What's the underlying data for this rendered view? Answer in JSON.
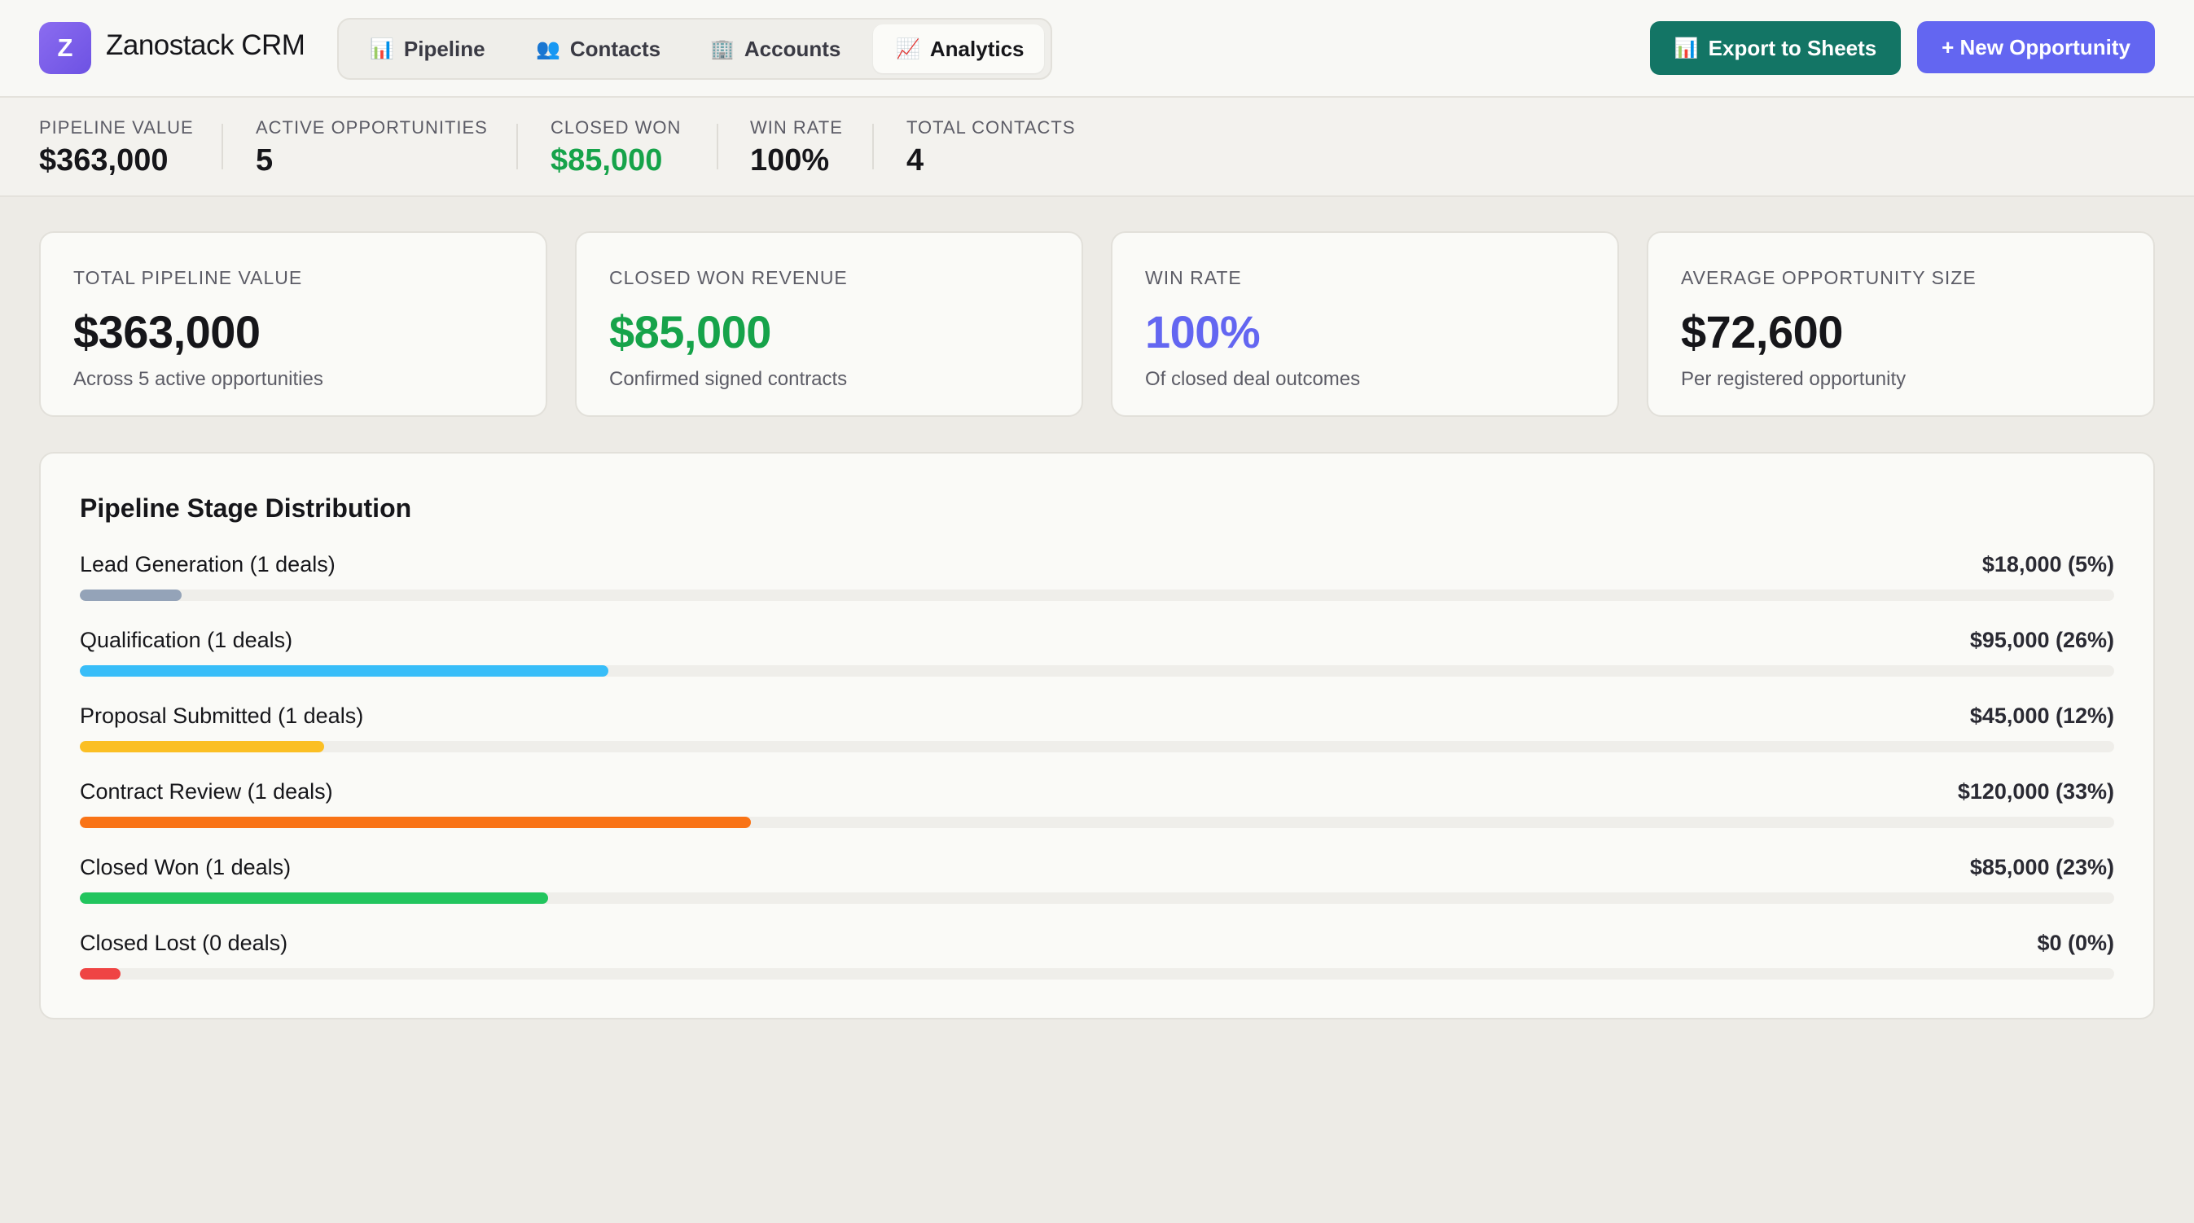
{
  "app": {
    "logo_letter": "Z",
    "title": "Zanostack CRM"
  },
  "nav": {
    "tabs": [
      {
        "label": "Pipeline",
        "icon": "📊",
        "icon_name": "bar-chart-icon"
      },
      {
        "label": "Contacts",
        "icon": "👥",
        "icon_name": "people-icon"
      },
      {
        "label": "Accounts",
        "icon": "🏢",
        "icon_name": "building-icon"
      },
      {
        "label": "Analytics",
        "icon": "📈",
        "icon_name": "trend-chart-icon",
        "active": true
      }
    ]
  },
  "actions": {
    "export_icon": "📊",
    "export_label": "Export to Sheets",
    "new_label": "+ New Opportunity"
  },
  "stats": {
    "pipeline_value_label": "PIPELINE VALUE",
    "pipeline_value": "$363,000",
    "active_opps_label": "ACTIVE OPPORTUNITIES",
    "active_opps": "5",
    "closed_won_label": "CLOSED WON",
    "closed_won": "$85,000",
    "win_rate_label": "WIN RATE",
    "win_rate": "100%",
    "total_contacts_label": "TOTAL CONTACTS",
    "total_contacts": "4"
  },
  "cards": [
    {
      "label": "TOTAL PIPELINE VALUE",
      "value": "$363,000",
      "sub": "Across 5 active opportunities"
    },
    {
      "label": "CLOSED WON REVENUE",
      "value": "$85,000",
      "sub": "Confirmed signed contracts"
    },
    {
      "label": "WIN RATE",
      "value": "100%",
      "sub": "Of closed deal outcomes"
    },
    {
      "label": "AVERAGE OPPORTUNITY SIZE",
      "value": "$72,600",
      "sub": "Per registered opportunity"
    }
  ],
  "distribution": {
    "title": "Pipeline Stage Distribution",
    "stages": [
      {
        "label": "Lead Generation (1 deals)",
        "amount": "$18,000 (5%)",
        "percent": 5,
        "color": "#94a3b8"
      },
      {
        "label": "Qualification (1 deals)",
        "amount": "$95,000 (26%)",
        "percent": 26,
        "color": "#38bdf8"
      },
      {
        "label": "Proposal Submitted (1 deals)",
        "amount": "$45,000 (12%)",
        "percent": 12,
        "color": "#fbbf24"
      },
      {
        "label": "Contract Review (1 deals)",
        "amount": "$120,000 (33%)",
        "percent": 33,
        "color": "#f97316"
      },
      {
        "label": "Closed Won (1 deals)",
        "amount": "$85,000 (23%)",
        "percent": 23,
        "color": "#22c55e"
      },
      {
        "label": "Closed Lost (0 deals)",
        "amount": "$0 (0%)",
        "percent": 2,
        "color": "#ef4444"
      }
    ]
  }
}
